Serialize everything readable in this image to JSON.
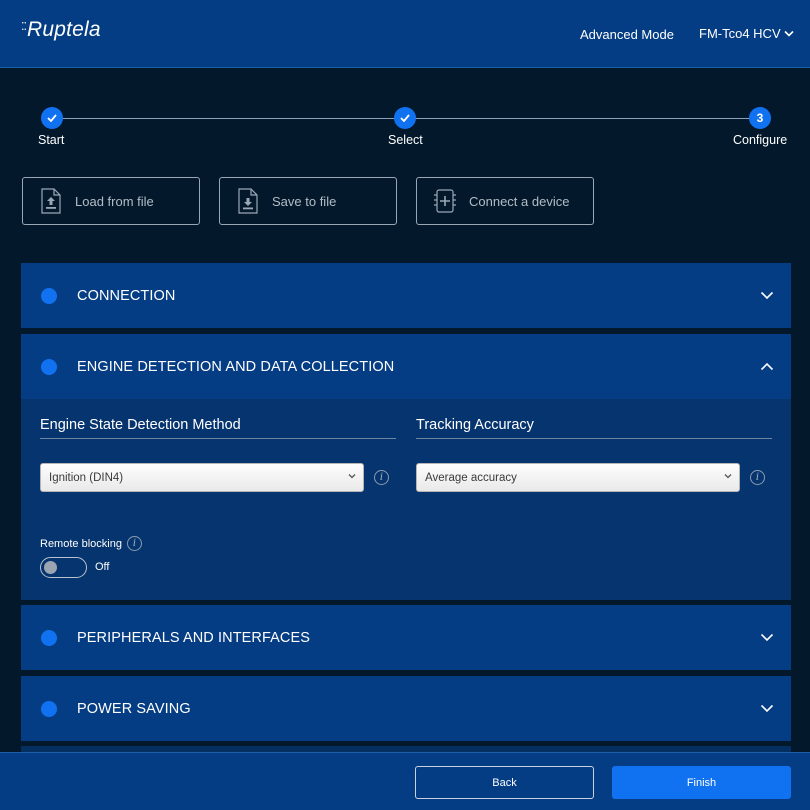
{
  "header": {
    "logo": "Ruptela",
    "advanced_mode": "Advanced Mode",
    "device": "FM-Tco4 HCV"
  },
  "stepper": {
    "steps": [
      {
        "label": "Start",
        "state": "done"
      },
      {
        "label": "Select",
        "state": "done"
      },
      {
        "label": "Configure",
        "number": "3",
        "state": "active"
      }
    ]
  },
  "actions": {
    "load": "Load from file",
    "save": "Save to file",
    "connect": "Connect a device"
  },
  "sections": {
    "connection": "CONNECTION",
    "engine": "ENGINE DETECTION AND DATA COLLECTION",
    "peripherals": "PERIPHERALS AND INTERFACES",
    "power": "POWER SAVING"
  },
  "engine": {
    "detection_title": "Engine State Detection Method",
    "detection_value": "Ignition (DIN4)",
    "accuracy_title": "Tracking Accuracy",
    "accuracy_value": "Average accuracy",
    "remote_blocking_label": "Remote blocking",
    "remote_blocking_state": "Off"
  },
  "footer": {
    "back": "Back",
    "finish": "Finish"
  },
  "colors": {
    "header_bg": "#053d84",
    "page_bg": "#03192b",
    "accent": "#1172f1",
    "section_body_bg": "#06346e"
  }
}
